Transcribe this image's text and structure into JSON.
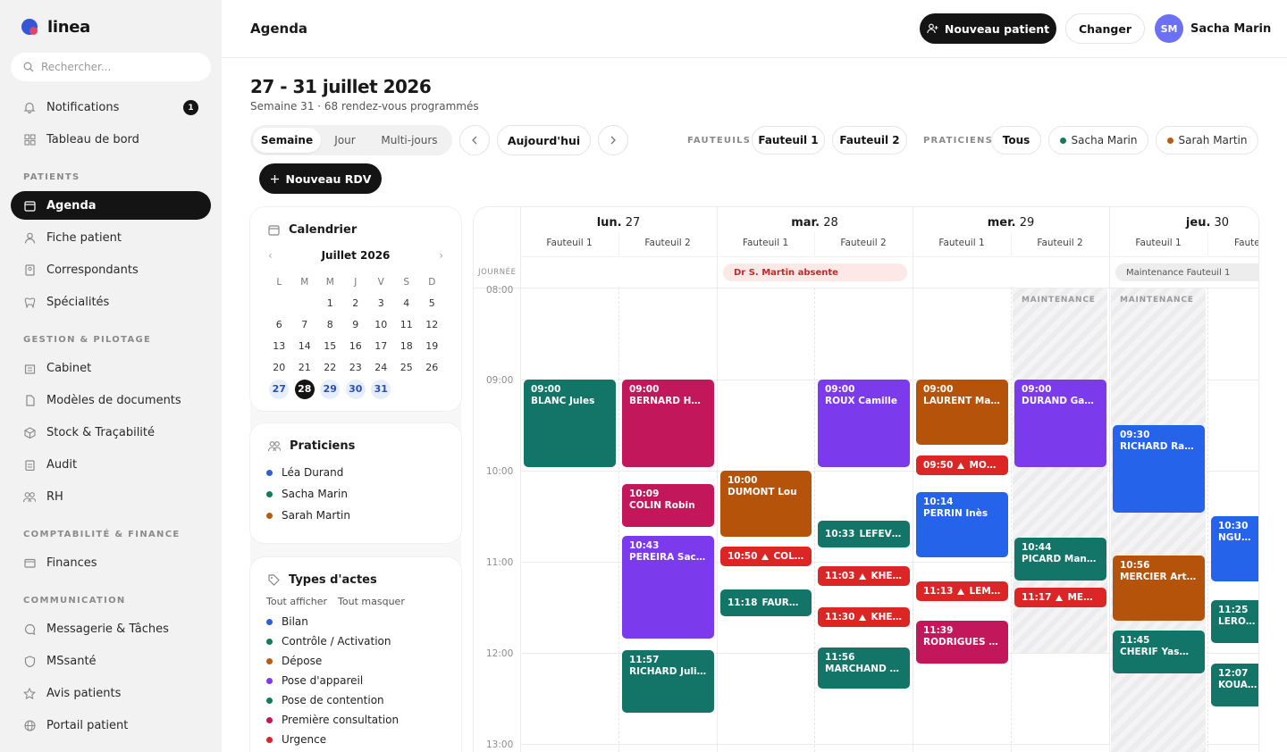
{
  "app": {
    "name": "linea"
  },
  "search": {
    "placeholder": "Rechercher..."
  },
  "nav": {
    "notifications": {
      "label": "Notifications",
      "badge": "1"
    },
    "dashboard": "Tableau de bord",
    "section_patients": "PATIENTS",
    "agenda": "Agenda",
    "patient_file": "Fiche patient",
    "correspondents": "Correspondants",
    "specialties": "Spécialités",
    "section_management": "GESTION & PILOTAGE",
    "office": "Cabinet",
    "templates": "Modèles de documents",
    "stock": "Stock & Traçabilité",
    "audit": "Audit",
    "hr": "RH",
    "section_finance": "COMPTABILITÉ & FINANCE",
    "finances": "Finances",
    "section_comm": "COMMUNICATION",
    "messaging": "Messagerie & Tâches",
    "mssante": "MSsanté",
    "reviews": "Avis patients",
    "portal": "Portail patient"
  },
  "header": {
    "title": "Agenda",
    "new_patient": "Nouveau patient",
    "change": "Changer",
    "user_initials": "SM",
    "user_name": "Sacha Marin"
  },
  "week": {
    "title": "27 - 31 juillet 2026",
    "subtitle": "Semaine 31 · 68 rendez-vous programmés"
  },
  "views": {
    "week": "Semaine",
    "day": "Jour",
    "multi": "Multi-jours"
  },
  "today": "Aujourd'hui",
  "filters": {
    "chairs_label": "FAUTEUILS",
    "chair1": "Fauteuil 1",
    "chair2": "Fauteuil 2",
    "practitioners_label": "PRATICIENS",
    "all": "Tous",
    "p1": "Sacha Marin",
    "p2": "Sarah Martin"
  },
  "new_rdv": "Nouveau RDV",
  "calendar": {
    "title": "Calendrier",
    "month": "Juillet 2026",
    "dow": [
      "L",
      "M",
      "M",
      "J",
      "V",
      "S",
      "D"
    ],
    "weeks": [
      [
        "",
        "",
        "1",
        "2",
        "3",
        "4",
        "5"
      ],
      [
        "6",
        "7",
        "8",
        "9",
        "10",
        "11",
        "12"
      ],
      [
        "13",
        "14",
        "15",
        "16",
        "17",
        "18",
        "19"
      ],
      [
        "20",
        "21",
        "22",
        "23",
        "24",
        "25",
        "26"
      ],
      [
        "27",
        "28",
        "29",
        "30",
        "31",
        "",
        ""
      ]
    ]
  },
  "practitioners": {
    "title": "Praticiens",
    "items": [
      {
        "name": "Léa Durand",
        "color": "#2f5fd0"
      },
      {
        "name": "Sacha Marin",
        "color": "#137a5e"
      },
      {
        "name": "Sarah Martin",
        "color": "#b85d10"
      }
    ]
  },
  "acts": {
    "title": "Types d'actes",
    "show_all": "Tout afficher",
    "hide_all": "Tout masquer",
    "items": [
      {
        "name": "Bilan",
        "color": "#2f5fd0"
      },
      {
        "name": "Contrôle / Activation",
        "color": "#137a5e"
      },
      {
        "name": "Dépose",
        "color": "#b85d10"
      },
      {
        "name": "Pose d'appareil",
        "color": "#7c3aed"
      },
      {
        "name": "Pose de contention",
        "color": "#137a5e"
      },
      {
        "name": "Première consultation",
        "color": "#c2185b"
      },
      {
        "name": "Urgence",
        "color": "#dc2626"
      }
    ]
  },
  "grid": {
    "allday_label": "JOURNÉE",
    "days": [
      {
        "name": "lun.",
        "num": "27"
      },
      {
        "name": "mar.",
        "num": "28"
      },
      {
        "name": "mer.",
        "num": "29"
      },
      {
        "name": "jeu.",
        "num": "30"
      }
    ],
    "chair1": "Fauteuil 1",
    "chair2": "Fauteuil 2",
    "chair2_cut": "Fauteu",
    "hours": [
      "08:00",
      "09:00",
      "10:00",
      "11:00",
      "12:00",
      "13:00"
    ],
    "allday_events": [
      "Dr S. Martin absente",
      "Maintenance Fauteuil 1"
    ],
    "maintenance": "MAINTENANCE",
    "events": [
      {
        "time": "09:00",
        "name": "BLANC Jules"
      },
      {
        "time": "09:00",
        "name": "BERNARD Hugo"
      },
      {
        "time": "10:09",
        "name": "COLIN Robin"
      },
      {
        "time": "10:43",
        "name": "PEREIRA Sacha"
      },
      {
        "time": "11:57",
        "name": "RICHARD Juliette"
      },
      {
        "time": "10:00",
        "name": "DUMONT Lou"
      },
      {
        "time": "10:50",
        "name": "COLIN ..."
      },
      {
        "time": "11:18",
        "name": "FAURE Inès"
      },
      {
        "time": "09:00",
        "name": "ROUX Camille"
      },
      {
        "time": "10:33",
        "name": "LEFEVRE..."
      },
      {
        "time": "11:03",
        "name": "KHELI..."
      },
      {
        "time": "11:30",
        "name": "KHELI..."
      },
      {
        "time": "11:56",
        "name": "MARCHAND Si..."
      },
      {
        "time": "09:00",
        "name": "LAURENT Malik"
      },
      {
        "time": "09:50",
        "name": "MORE..."
      },
      {
        "time": "10:14",
        "name": "PERRIN Inès"
      },
      {
        "time": "11:13",
        "name": "LEMAI..."
      },
      {
        "time": "11:39",
        "name": "RODRIGUES Ra..."
      },
      {
        "time": "09:00",
        "name": "DURAND Gabriel"
      },
      {
        "time": "10:44",
        "name": "PICARD Manon"
      },
      {
        "time": "11:17",
        "name": "MERCI..."
      },
      {
        "time": "09:30",
        "name": "RICHARD Raph..."
      },
      {
        "time": "10:56",
        "name": "MERCIER Arthur"
      },
      {
        "time": "11:45",
        "name": "CHERIF Yasmina"
      },
      {
        "time": "10:30",
        "name": "NGUYEN"
      },
      {
        "time": "11:25",
        "name": "LEROUX"
      },
      {
        "time": "12:07",
        "name": "KOUASSI"
      }
    ]
  }
}
